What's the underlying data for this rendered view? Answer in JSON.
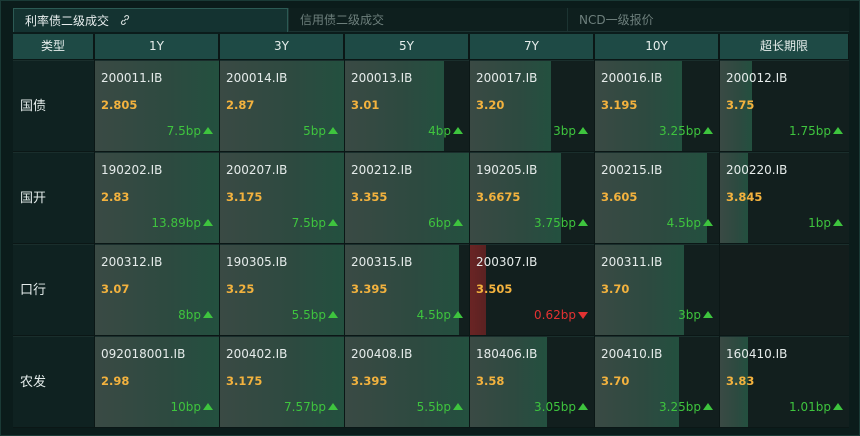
{
  "tabs": [
    {
      "label": "利率债二级成交",
      "active": true
    },
    {
      "label": "信用债二级成交",
      "active": false
    },
    {
      "label": "NCD一级报价",
      "active": false
    }
  ],
  "header": {
    "type_label": "类型",
    "columns": [
      "1Y",
      "3Y",
      "5Y",
      "7Y",
      "10Y",
      "超长期限"
    ]
  },
  "colors": {
    "up": "#3ec43e",
    "down": "#e33232",
    "rate": "#f3b23e",
    "header_bg": "#1e4a45"
  },
  "rows": [
    {
      "label": "国债",
      "cells": [
        {
          "code": "200011.IB",
          "rate": "2.805",
          "change": "7.5bp",
          "dir": "up",
          "fill": 1.0
        },
        {
          "code": "200014.IB",
          "rate": "2.87",
          "change": "5bp",
          "dir": "up",
          "fill": 1.0
        },
        {
          "code": "200013.IB",
          "rate": "3.01",
          "change": "4bp",
          "dir": "up",
          "fill": 0.8
        },
        {
          "code": "200017.IB",
          "rate": "3.20",
          "change": "3bp",
          "dir": "up",
          "fill": 0.65
        },
        {
          "code": "200016.IB",
          "rate": "3.195",
          "change": "3.25bp",
          "dir": "up",
          "fill": 0.7
        },
        {
          "code": "200012.IB",
          "rate": "3.75",
          "change": "1.75bp",
          "dir": "up",
          "fill": 0.25
        }
      ]
    },
    {
      "label": "国开",
      "cells": [
        {
          "code": "190202.IB",
          "rate": "2.83",
          "change": "13.89bp",
          "dir": "up",
          "fill": 1.0
        },
        {
          "code": "200207.IB",
          "rate": "3.175",
          "change": "7.5bp",
          "dir": "up",
          "fill": 1.0
        },
        {
          "code": "200212.IB",
          "rate": "3.355",
          "change": "6bp",
          "dir": "up",
          "fill": 1.0
        },
        {
          "code": "190205.IB",
          "rate": "3.6675",
          "change": "3.75bp",
          "dir": "up",
          "fill": 0.73
        },
        {
          "code": "200215.IB",
          "rate": "3.605",
          "change": "4.5bp",
          "dir": "up",
          "fill": 0.9
        },
        {
          "code": "200220.IB",
          "rate": "3.845",
          "change": "1bp",
          "dir": "up",
          "fill": 0.22
        }
      ]
    },
    {
      "label": "口行",
      "cells": [
        {
          "code": "200312.IB",
          "rate": "3.07",
          "change": "8bp",
          "dir": "up",
          "fill": 1.0
        },
        {
          "code": "190305.IB",
          "rate": "3.25",
          "change": "5.5bp",
          "dir": "up",
          "fill": 1.0
        },
        {
          "code": "200315.IB",
          "rate": "3.395",
          "change": "4.5bp",
          "dir": "up",
          "fill": 0.92
        },
        {
          "code": "200307.IB",
          "rate": "3.505",
          "change": "0.62bp",
          "dir": "down",
          "fill": 0.13
        },
        {
          "code": "200311.IB",
          "rate": "3.70",
          "change": "3bp",
          "dir": "up",
          "fill": 0.72
        },
        {
          "code": "",
          "rate": "",
          "change": "",
          "dir": "",
          "fill": 0
        }
      ]
    },
    {
      "label": "农发",
      "cells": [
        {
          "code": "092018001.IB",
          "rate": "2.98",
          "change": "10bp",
          "dir": "up",
          "fill": 1.0
        },
        {
          "code": "200402.IB",
          "rate": "3.175",
          "change": "7.57bp",
          "dir": "up",
          "fill": 1.0
        },
        {
          "code": "200408.IB",
          "rate": "3.395",
          "change": "5.5bp",
          "dir": "up",
          "fill": 1.0
        },
        {
          "code": "180406.IB",
          "rate": "3.58",
          "change": "3.05bp",
          "dir": "up",
          "fill": 0.62
        },
        {
          "code": "200410.IB",
          "rate": "3.70",
          "change": "3.25bp",
          "dir": "up",
          "fill": 0.68
        },
        {
          "code": "160410.IB",
          "rate": "3.83",
          "change": "1.01bp",
          "dir": "up",
          "fill": 0.22
        }
      ]
    }
  ]
}
